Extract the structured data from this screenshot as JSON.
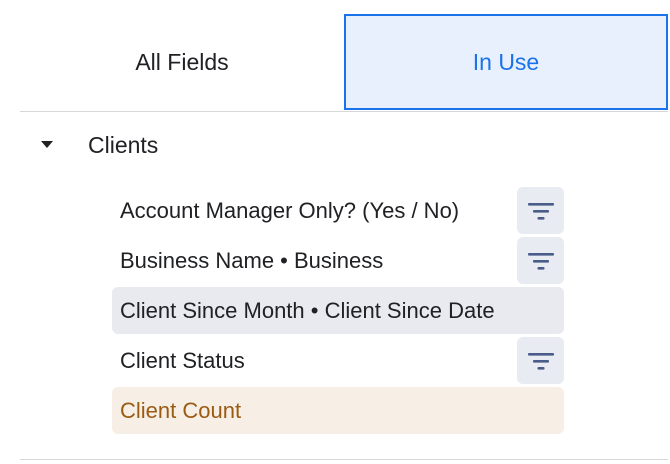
{
  "tabs": [
    {
      "label": "All Fields",
      "active": false
    },
    {
      "label": "In Use",
      "active": true
    }
  ],
  "group": {
    "label": "Clients",
    "expanded": true
  },
  "fields": [
    {
      "label": "Account Manager Only? (Yes / No)",
      "filtered": true
    },
    {
      "label": "Business Name • Business",
      "filtered": true
    },
    {
      "label": "Client Since Month • Client Since Date",
      "filtered": false,
      "selected": true
    },
    {
      "label": "Client Status",
      "filtered": true
    },
    {
      "label": "Client Count",
      "filtered": false,
      "measure": true
    }
  ],
  "icons": {
    "caret": "caret-down-icon",
    "filter": "filter-icon"
  },
  "colors": {
    "accent": "#1a73e8",
    "active_tab_bg": "#e8f0fe",
    "selected_row_bg": "#e8eaf0",
    "measure_row_bg": "#f7efe6",
    "measure_text": "#9a5b13",
    "filter_icon": "#4a5d8a"
  }
}
